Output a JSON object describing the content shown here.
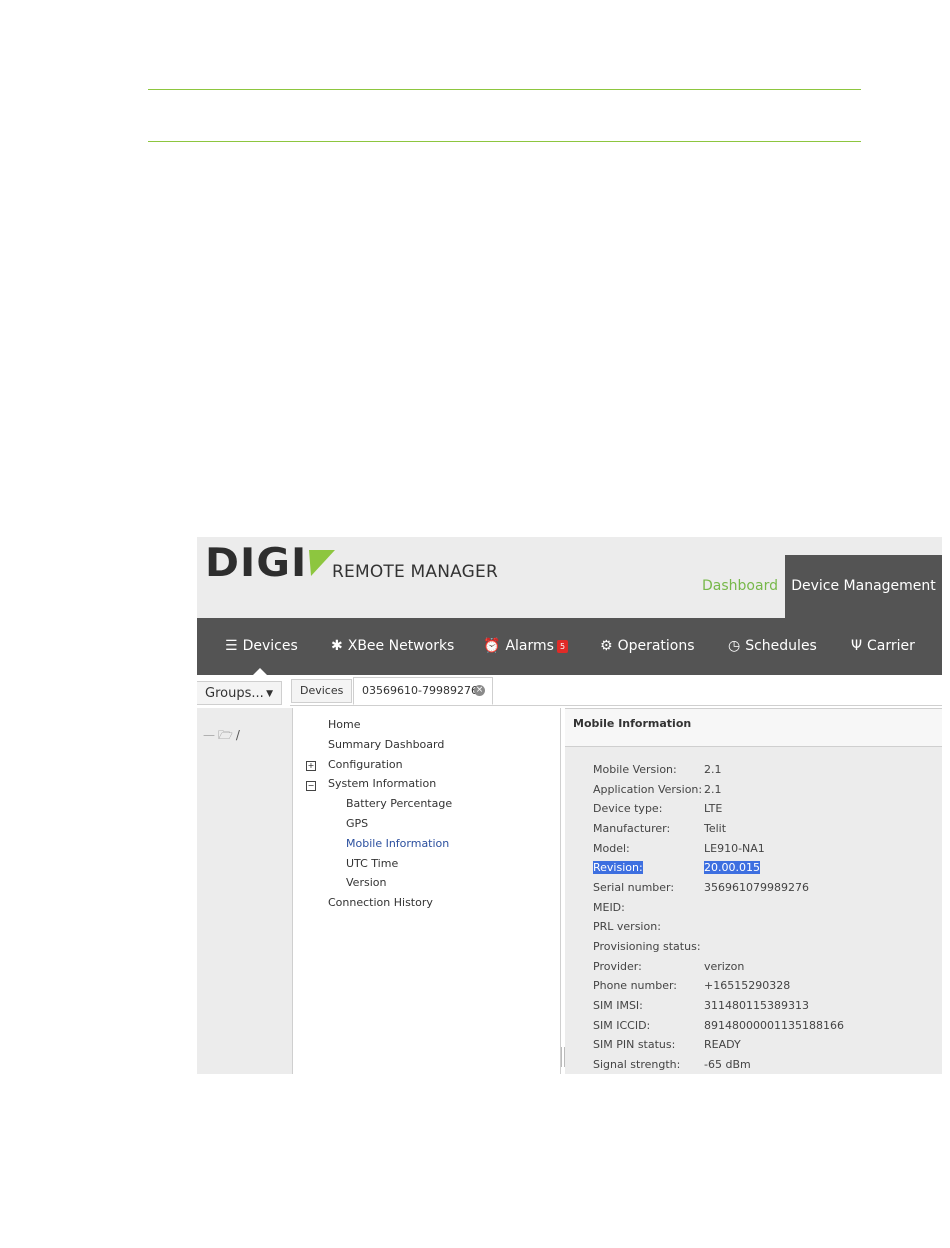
{
  "app": {
    "logo_text": "DIGI",
    "name": "REMOTE MANAGER"
  },
  "top_tabs": {
    "dashboard": "Dashboard",
    "device_management": "Device Management"
  },
  "nav": {
    "devices": "Devices",
    "xbee": "XBee Networks",
    "alarms": "Alarms",
    "alarms_badge": "5",
    "operations": "Operations",
    "schedules": "Schedules",
    "carrier": "Carrier"
  },
  "strip": {
    "groups_label": "Groups...",
    "tab_devices": "Devices",
    "tab_device_id": "03569610-79989276"
  },
  "groups_tree": {
    "root": "/"
  },
  "tree": {
    "home": "Home",
    "summary": "Summary Dashboard",
    "configuration": "Configuration",
    "system_information": "System Information",
    "battery": "Battery Percentage",
    "gps": "GPS",
    "mobile_info": "Mobile Information",
    "utc": "UTC Time",
    "version": "Version",
    "connection_history": "Connection History"
  },
  "info": {
    "title": "Mobile Information",
    "rows": [
      {
        "k": "Mobile Version:",
        "v": "2.1"
      },
      {
        "k": "Application Version:",
        "v": "2.1"
      },
      {
        "k": "Device type:",
        "v": "LTE"
      },
      {
        "k": "Manufacturer:",
        "v": "Telit"
      },
      {
        "k": "Model:",
        "v": "LE910-NA1"
      },
      {
        "k": "Revision:",
        "v": "20.00.015"
      },
      {
        "k": "Serial number:",
        "v": "356961079989276"
      },
      {
        "k": "MEID:",
        "v": ""
      },
      {
        "k": "PRL version:",
        "v": ""
      },
      {
        "k": "Provisioning status:",
        "v": ""
      },
      {
        "k": "Provider:",
        "v": "verizon"
      },
      {
        "k": "Phone number:",
        "v": "+16515290328"
      },
      {
        "k": "SIM IMSI:",
        "v": "311480115389313"
      },
      {
        "k": "SIM ICCID:",
        "v": "89148000001135188166"
      },
      {
        "k": "SIM PIN status:",
        "v": "READY"
      },
      {
        "k": "Signal strength:",
        "v": "-65 dBm"
      }
    ]
  },
  "colors": {
    "accent_green": "#8dc63f",
    "nav_bg": "#545454",
    "selection": "#3d6fe0"
  }
}
